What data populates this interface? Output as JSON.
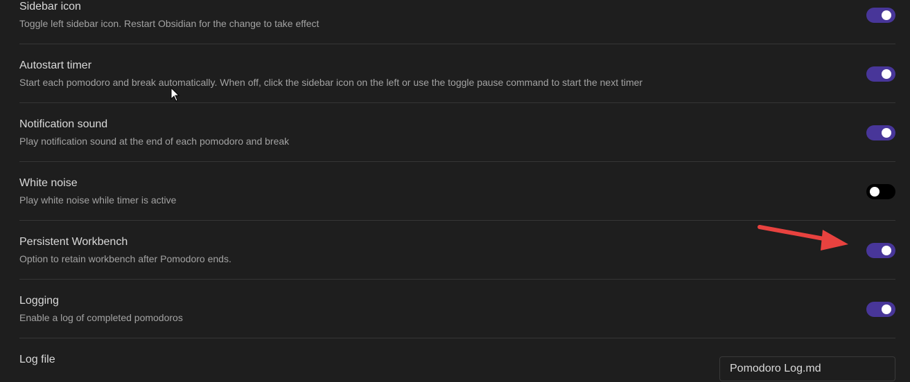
{
  "settings": [
    {
      "name": "Sidebar icon",
      "desc": "Toggle left sidebar icon. Restart Obsidian for the change to take effect",
      "state": "on"
    },
    {
      "name": "Autostart timer",
      "desc": "Start each pomodoro and break automatically. When off, click the sidebar icon on the left or use the toggle pause command to start the next timer",
      "state": "on"
    },
    {
      "name": "Notification sound",
      "desc": "Play notification sound at the end of each pomodoro and break",
      "state": "on"
    },
    {
      "name": "White noise",
      "desc": "Play white noise while timer is active",
      "state": "off"
    },
    {
      "name": "Persistent Workbench",
      "desc": "Option to retain workbench after Pomodoro ends.",
      "state": "on"
    },
    {
      "name": "Logging",
      "desc": "Enable a log of completed pomodoros",
      "state": "on"
    },
    {
      "name": "Log file",
      "value": "Pomodoro Log.md"
    }
  ],
  "colors": {
    "toggle_on": "#483699",
    "toggle_off": "#000000",
    "annotation_arrow": "#e8423f"
  },
  "icons": {
    "annotation": "red-arrow-icon",
    "cursor": "mouse-pointer-icon"
  }
}
